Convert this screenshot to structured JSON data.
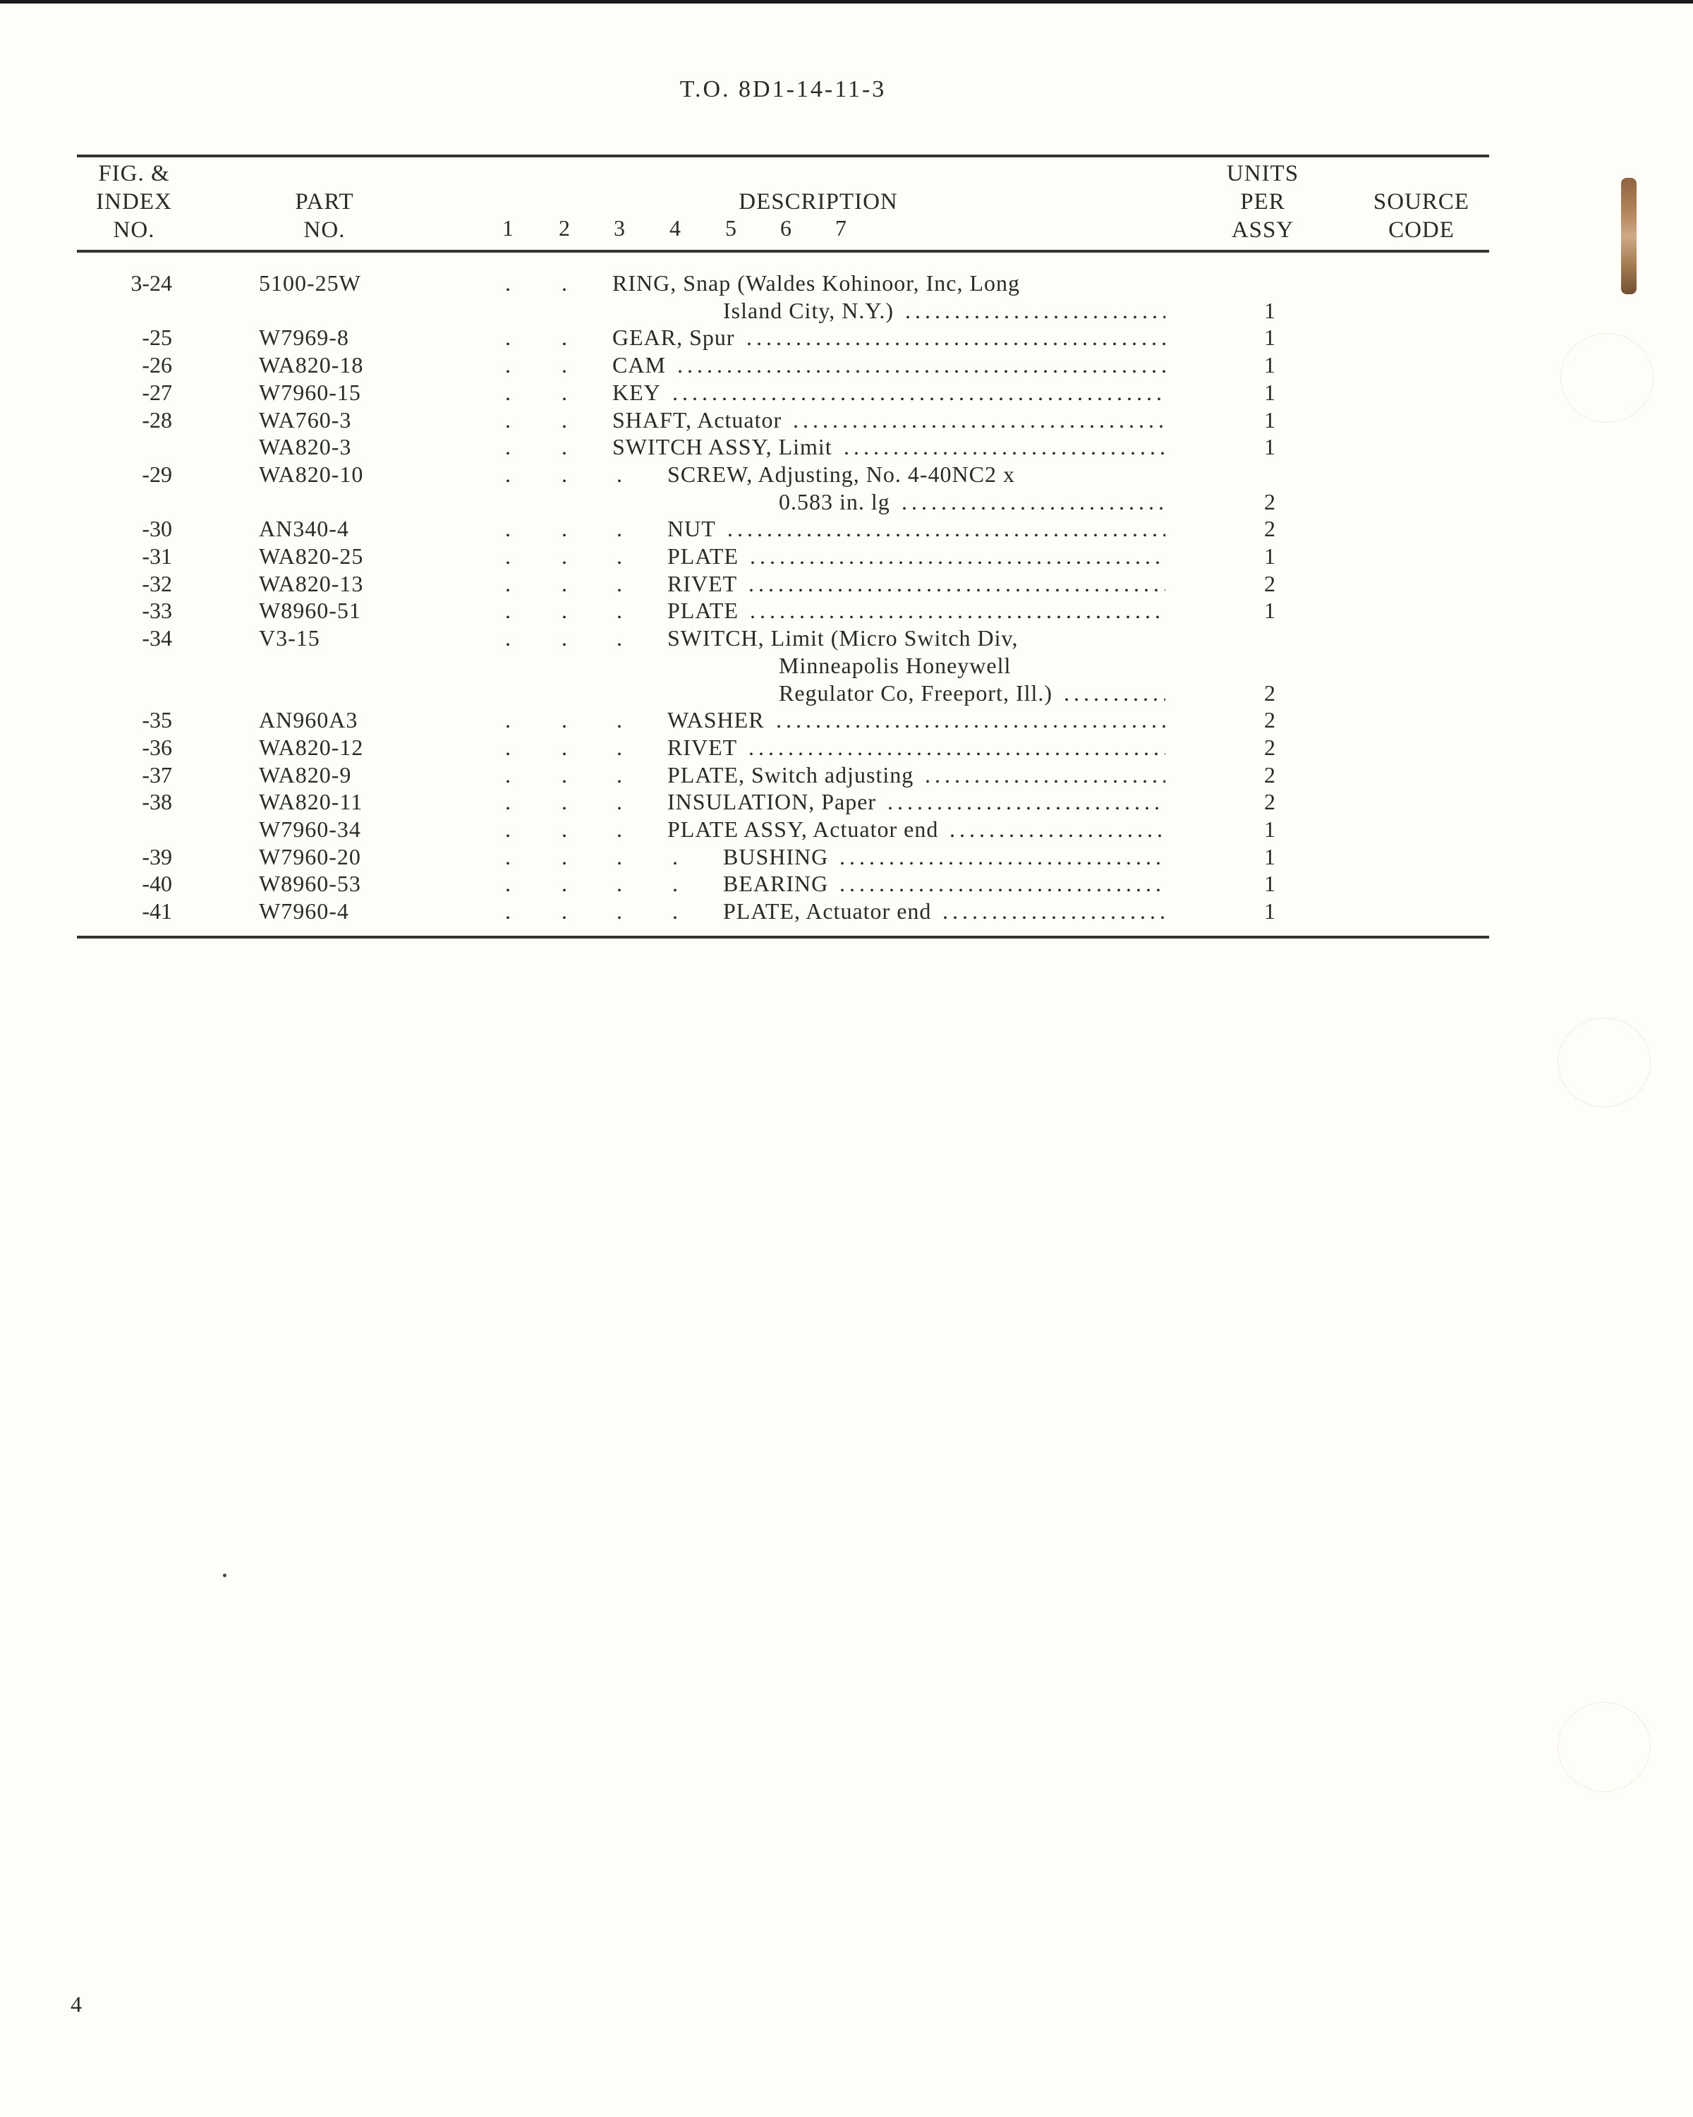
{
  "document": {
    "to_number": "T.O. 8D1-14-11-3",
    "page_number": "4"
  },
  "table": {
    "headers": {
      "fig_index": [
        "FIG. &",
        "INDEX",
        "NO."
      ],
      "part_no": [
        "PART",
        "NO."
      ],
      "description": "DESCRIPTION",
      "levels": [
        "1",
        "2",
        "3",
        "4",
        "5",
        "6",
        "7"
      ],
      "units_per_assy": [
        "UNITS",
        "PER",
        "ASSY"
      ],
      "source_code": [
        "SOURCE",
        "CODE"
      ]
    },
    "rows": [
      {
        "index": "3-24",
        "part": "5100-25W",
        "level": 3,
        "lines": [
          "RING, Snap (Waldes Kohinoor, Inc, Long",
          "Island City, N.Y.)"
        ],
        "units": "1",
        "source": ""
      },
      {
        "index": "-25",
        "part": "W7969-8",
        "level": 3,
        "lines": [
          "GEAR, Spur"
        ],
        "units": "1",
        "source": ""
      },
      {
        "index": "-26",
        "part": "WA820-18",
        "level": 3,
        "lines": [
          "CAM"
        ],
        "units": "1",
        "source": ""
      },
      {
        "index": "-27",
        "part": "W7960-15",
        "level": 3,
        "lines": [
          "KEY"
        ],
        "units": "1",
        "source": ""
      },
      {
        "index": "-28",
        "part": "WA760-3",
        "level": 3,
        "lines": [
          "SHAFT, Actuator"
        ],
        "units": "1",
        "source": ""
      },
      {
        "index": "",
        "part": "WA820-3",
        "level": 3,
        "lines": [
          "SWITCH ASSY, Limit"
        ],
        "units": "1",
        "source": ""
      },
      {
        "index": "-29",
        "part": "WA820-10",
        "level": 4,
        "lines": [
          "SCREW, Adjusting, No. 4-40NC2 x",
          "0.583 in. lg"
        ],
        "units": "2",
        "source": ""
      },
      {
        "index": "-30",
        "part": "AN340-4",
        "level": 4,
        "lines": [
          "NUT"
        ],
        "units": "2",
        "source": ""
      },
      {
        "index": "-31",
        "part": "WA820-25",
        "level": 4,
        "lines": [
          "PLATE"
        ],
        "units": "1",
        "source": ""
      },
      {
        "index": "-32",
        "part": "WA820-13",
        "level": 4,
        "lines": [
          "RIVET"
        ],
        "units": "2",
        "source": ""
      },
      {
        "index": "-33",
        "part": "W8960-51",
        "level": 4,
        "lines": [
          "PLATE"
        ],
        "units": "1",
        "source": ""
      },
      {
        "index": "-34",
        "part": "V3-15",
        "level": 4,
        "lines": [
          "SWITCH, Limit (Micro Switch Div,",
          "Minneapolis Honeywell",
          "Regulator Co, Freeport, Ill.)"
        ],
        "units": "2",
        "source": ""
      },
      {
        "index": "-35",
        "part": "AN960A3",
        "level": 4,
        "lines": [
          "WASHER"
        ],
        "units": "2",
        "source": ""
      },
      {
        "index": "-36",
        "part": "WA820-12",
        "level": 4,
        "lines": [
          "RIVET"
        ],
        "units": "2",
        "source": ""
      },
      {
        "index": "-37",
        "part": "WA820-9",
        "level": 4,
        "lines": [
          "PLATE, Switch adjusting"
        ],
        "units": "2",
        "source": ""
      },
      {
        "index": "-38",
        "part": "WA820-11",
        "level": 4,
        "lines": [
          "INSULATION, Paper"
        ],
        "units": "2",
        "source": ""
      },
      {
        "index": "",
        "part": "W7960-34",
        "level": 4,
        "lines": [
          "PLATE ASSY, Actuator end"
        ],
        "units": "1",
        "source": ""
      },
      {
        "index": "-39",
        "part": "W7960-20",
        "level": 5,
        "lines": [
          "BUSHING"
        ],
        "units": "1",
        "source": ""
      },
      {
        "index": "-40",
        "part": "W8960-53",
        "level": 5,
        "lines": [
          "BEARING"
        ],
        "units": "1",
        "source": ""
      },
      {
        "index": "-41",
        "part": "W7960-4",
        "level": 5,
        "lines": [
          "PLATE, Actuator end"
        ],
        "units": "1",
        "source": ""
      }
    ]
  }
}
